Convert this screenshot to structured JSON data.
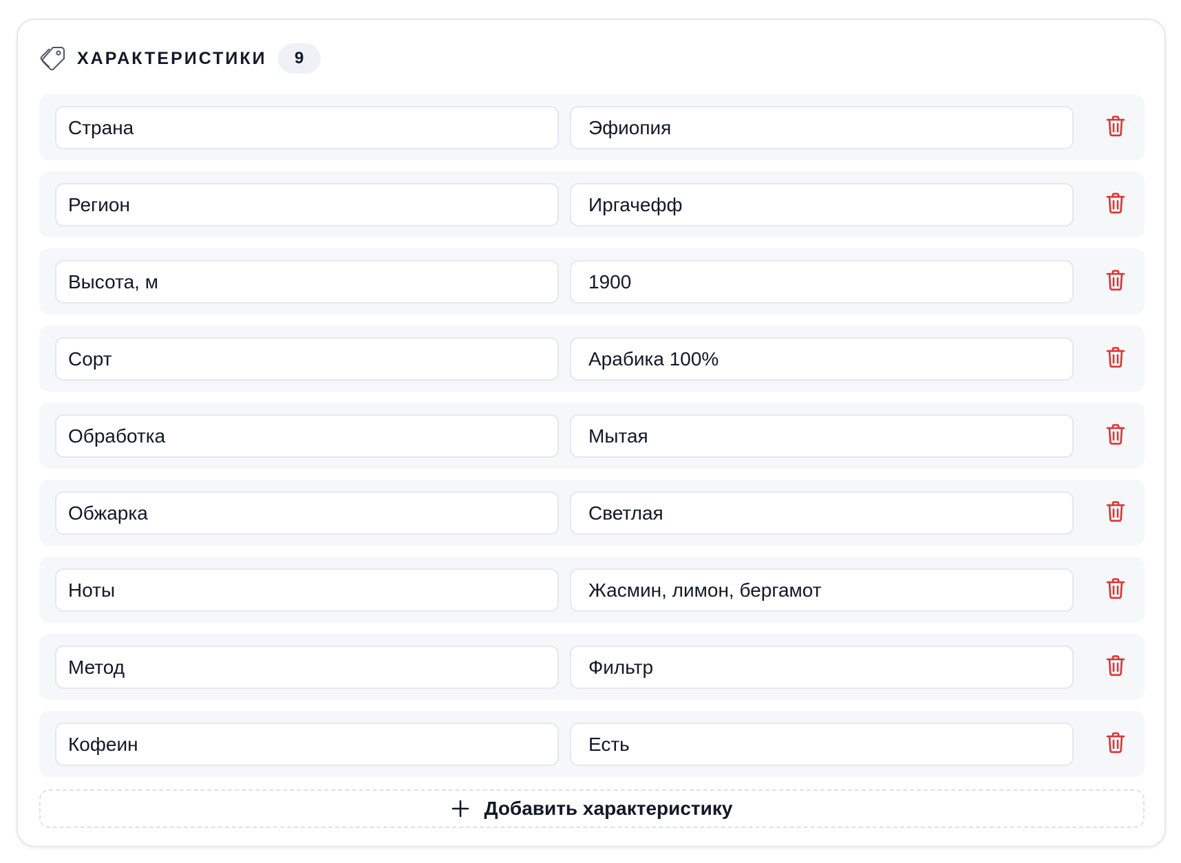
{
  "section": {
    "icon": "tag-icon",
    "title": "ХАРАКТЕРИСТИКИ",
    "count": "9"
  },
  "attributes": [
    {
      "key": "Страна",
      "value": "Эфиопия"
    },
    {
      "key": "Регион",
      "value": "Иргачефф"
    },
    {
      "key": "Высота, м",
      "value": "1900"
    },
    {
      "key": "Сорт",
      "value": "Арабика 100%"
    },
    {
      "key": "Обработка",
      "value": "Мытая"
    },
    {
      "key": "Обжарка",
      "value": "Светлая"
    },
    {
      "key": "Ноты",
      "value": "Жасмин, лимон, бергамот"
    },
    {
      "key": "Метод",
      "value": "Фильтр"
    },
    {
      "key": "Кофеин",
      "value": "Есть"
    }
  ],
  "row_action": {
    "icon": "trash-icon"
  },
  "add_button": {
    "icon": "plus-icon",
    "label": "Добавить характеристику"
  },
  "colors": {
    "delete": "#e03131",
    "row_background": "#f6f7f9",
    "badge_background": "#eef1f6",
    "text": "#111827"
  }
}
